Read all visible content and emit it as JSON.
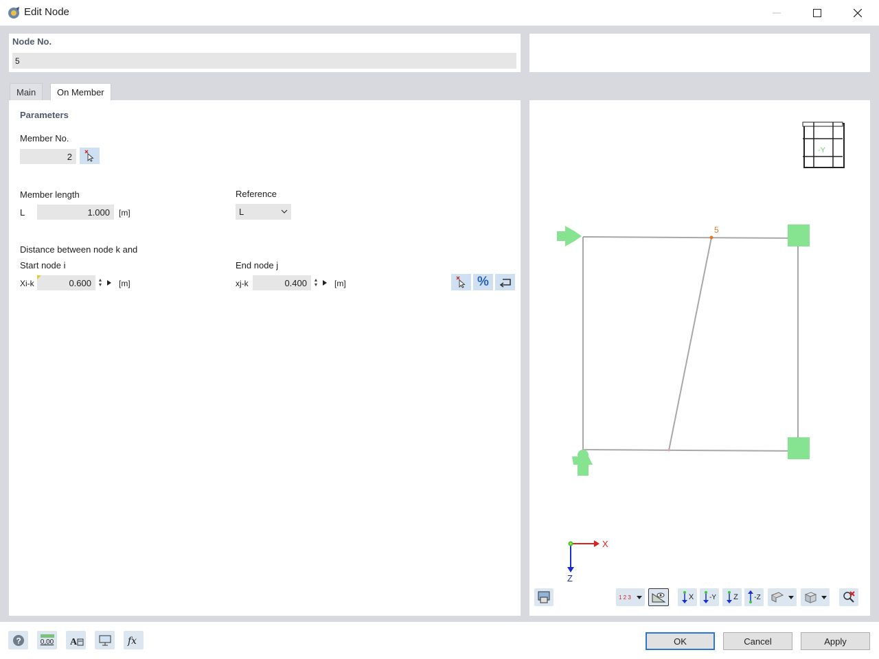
{
  "window": {
    "title": "Edit Node"
  },
  "node": {
    "label": "Node No.",
    "value": "5"
  },
  "tabs": [
    {
      "label": "Main"
    },
    {
      "label": "On Member"
    }
  ],
  "parameters": {
    "heading": "Parameters",
    "member_no_label": "Member No.",
    "member_no_value": "2",
    "member_length_label": "Member length",
    "length_symbol": "L",
    "length_value": "1.000",
    "length_unit": "[m]",
    "reference_label": "Reference",
    "reference_value": "L",
    "distance_label": "Distance between node k and",
    "start_label": "Start node i",
    "end_label": "End node j",
    "xik_label": "Xi-k",
    "xik_value": "0.600",
    "xik_unit": "[m]",
    "xjk_label": "xj-k",
    "xjk_value": "0.400",
    "xjk_unit": "[m]",
    "percent_symbol": "%"
  },
  "viewer": {
    "node_label": "5",
    "cube_label": "-Y",
    "axis_x": "X",
    "axis_z": "Z",
    "toolbar_numbers": "1 2 3",
    "view_x": "X",
    "view_neg_y": "-Y",
    "view_z": "Z",
    "view_neg_z": "-Z"
  },
  "bottom_icons": {
    "units_label": "0,00"
  },
  "buttons": {
    "ok": "OK",
    "cancel": "Cancel",
    "apply": "Apply"
  },
  "colors": {
    "accent": "#2b77d0",
    "support": "#86e38f",
    "node_label": "#e07a2a",
    "section_label": "#505a6e"
  }
}
